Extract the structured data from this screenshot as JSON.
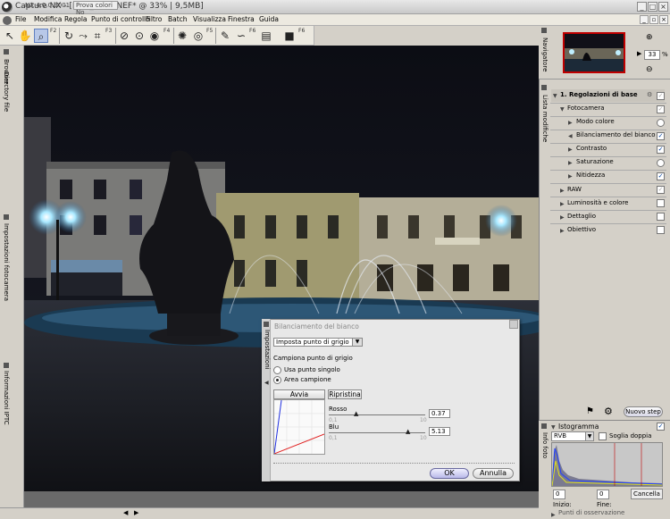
{
  "window": {
    "title": "Capture NX - [DAR_8175.NEF* @ 33% | 9,5MB]",
    "minimize": "_",
    "maximize": "□",
    "close": "×"
  },
  "menu": [
    "File",
    "Modifica",
    "Regola",
    "Punto di controllo",
    "Filtro",
    "Batch",
    "Visualizza",
    "Finestra",
    "Guida"
  ],
  "toolbar": {
    "fkeys": [
      "F2",
      "F3",
      "F4",
      "F5",
      "F6"
    ]
  },
  "left_tabs": [
    "Browser",
    "Directory file",
    "Impostazioni fotocamera",
    "Informazioni IPTC"
  ],
  "navigator": {
    "tab": "Navigatore",
    "zoom": "33",
    "percent": "%"
  },
  "edit_list": {
    "tab": "Lista modifiche",
    "step_title": "1. Regolazioni di base",
    "items": [
      {
        "label": "Fotocamera",
        "level": 1,
        "state": "check"
      },
      {
        "label": "Modo colore",
        "level": 2,
        "state": "radio"
      },
      {
        "label": "Bilanciamento del bianco",
        "level": 2,
        "state": "check"
      },
      {
        "label": "Contrasto",
        "level": 2,
        "state": "check"
      },
      {
        "label": "Saturazione",
        "level": 2,
        "state": "radio"
      },
      {
        "label": "Nitidezza",
        "level": 2,
        "state": "check"
      },
      {
        "label": "RAW",
        "level": 1,
        "state": "box"
      },
      {
        "label": "Luminosità e colore",
        "level": 1,
        "state": "box"
      },
      {
        "label": "Dettaglio",
        "level": 1,
        "state": "box"
      },
      {
        "label": "Obiettivo",
        "level": 1,
        "state": "box"
      }
    ],
    "new_step": "Nuovo step"
  },
  "histogram": {
    "tab_title": "Istogramma",
    "info_tab": "Info foto",
    "channel": "RVB",
    "double_threshold": "Soglia doppia",
    "start_label": "Inizio:",
    "start_value": "0",
    "end_label": "Fine:",
    "end_value": "0",
    "cancel": "Cancella",
    "next_panel": "Punti di osservazione"
  },
  "dialog": {
    "side_tab": "Impostazioni",
    "title": "Bilanciamento del bianco",
    "select_value": "Imposta punto di grigio",
    "sample_label": "Campiona punto di grigio",
    "option_single": "Usa punto singolo",
    "option_area": "Area campione",
    "start_btn": "Avvia",
    "reset_btn": "Ripristina",
    "red_label": "Rosso",
    "red_min": "0,1",
    "red_max": "10",
    "red_value": "0.37",
    "blue_label": "Blu",
    "blue_min": "0,1",
    "blue_max": "10",
    "blue_value": "5.13",
    "ok": "OK",
    "cancel": "Annulla"
  },
  "status": {
    "version": "NX 4.0.0.3001",
    "proof": "Prova colori No"
  }
}
